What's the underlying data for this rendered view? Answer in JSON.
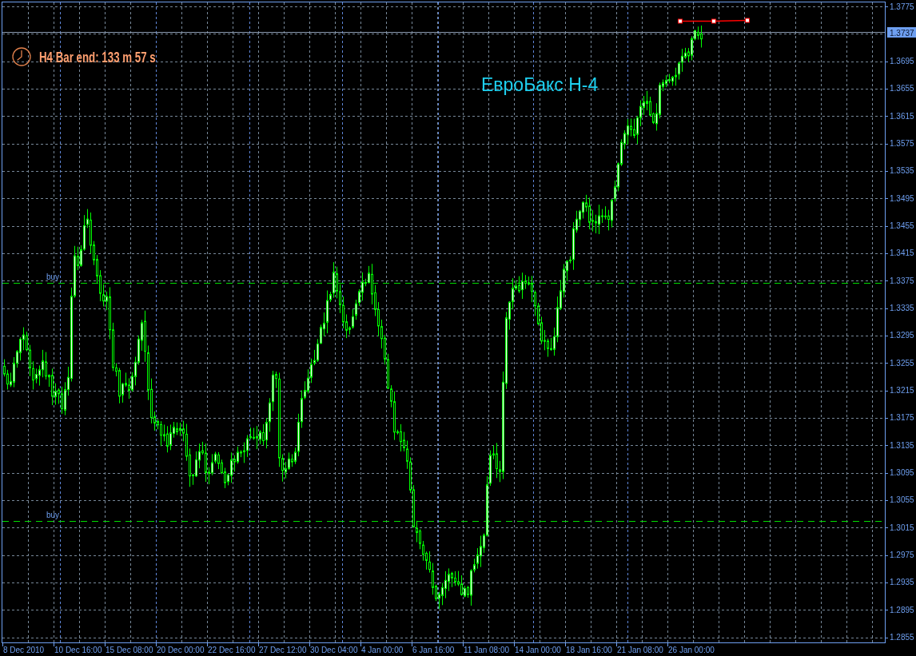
{
  "chart": {
    "title": "ЕвроБакс Н-4",
    "bar_timer": "H4 Bar end: 133 m 57 s",
    "current_price": "1.3737",
    "price_axis": [
      "1.3775",
      "1.3695",
      "1.3655",
      "1.3615",
      "1.3575",
      "1.3535",
      "1.3495",
      "1.3455",
      "1.3415",
      "1.3375",
      "1.3335",
      "1.3295",
      "1.3255",
      "1.3215",
      "1.3175",
      "1.3135",
      "1.3095",
      "1.3055",
      "1.3015",
      "1.2975",
      "1.2935",
      "1.2895",
      "1.2855"
    ],
    "time_axis": [
      "8 Dec 2010",
      "10 Dec 16:00",
      "15 Dec 08:00",
      "20 Dec 00:00",
      "22 Dec 16:00",
      "27 Dec 12:00",
      "30 Dec 04:00",
      "4 Jan 00:00",
      "6 Jan 16:00",
      "11 Jan 08:00",
      "14 Jan 00:00",
      "18 Jan 16:00",
      "21 Jan 08:00",
      "26 Jan 00:00"
    ],
    "order_lines": [
      {
        "label": "buy"
      },
      {
        "label": "buy"
      }
    ]
  }
}
